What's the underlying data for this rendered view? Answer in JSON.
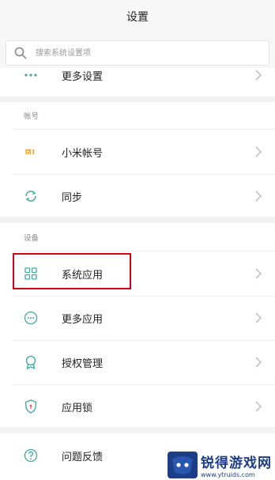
{
  "header": {
    "title": "设置"
  },
  "search": {
    "placeholder": "搜索系统设置项"
  },
  "top_partial": {
    "label": "更多设置"
  },
  "account_section": {
    "title": "帐号",
    "items": [
      {
        "label": "小米帐号",
        "icon": "mi-logo-icon"
      },
      {
        "label": "同步",
        "icon": "sync-icon"
      }
    ]
  },
  "device_section": {
    "title": "设备",
    "items": [
      {
        "label": "系统应用",
        "icon": "grid-apps-icon"
      },
      {
        "label": "更多应用",
        "icon": "more-apps-icon"
      },
      {
        "label": "授权管理",
        "icon": "badge-icon"
      },
      {
        "label": "应用锁",
        "icon": "shield-lock-icon"
      }
    ]
  },
  "feedback_section": {
    "items": [
      {
        "label": "问题反馈",
        "icon": "question-icon"
      }
    ]
  },
  "watermark": {
    "name": "锐得游戏网",
    "url": "www.ytruids.com"
  },
  "colors": {
    "accent": "#3fa7a0",
    "mi_orange": "#f5a623",
    "highlight": "#d0021b"
  }
}
